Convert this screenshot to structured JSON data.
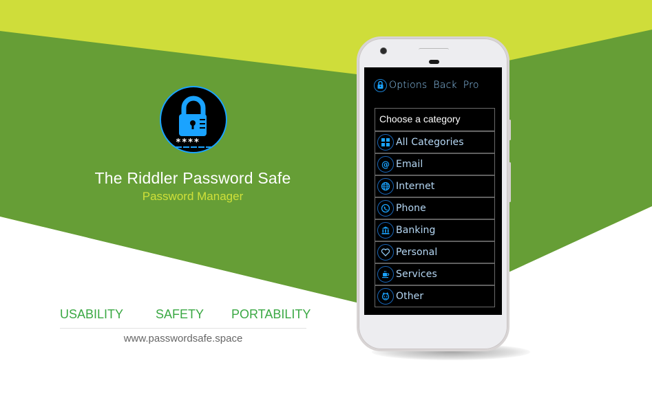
{
  "colors": {
    "lime": "#cfdd3a",
    "green": "#669e36",
    "white": "#ffffff",
    "accent_blue": "#1aa3ff",
    "feature_green": "#3aa843",
    "subtitle_lime": "#cfe03a"
  },
  "branding": {
    "logo_icon": "padlock-with-password-icon",
    "logo_mask": "****",
    "title": "The Riddler Password Safe",
    "subtitle": "Password Manager"
  },
  "features": [
    "USABILITY",
    "SAFETY",
    "PORTABILITY"
  ],
  "website": "www.passwordsafe.space",
  "app": {
    "toolbar": {
      "icon": "lock-icon",
      "menu": [
        "Options",
        "Back",
        "Pro"
      ]
    },
    "category_dropdown": {
      "header": "Choose a category",
      "items": [
        {
          "label": "All Categories",
          "icon": "grid-icon"
        },
        {
          "label": "Email",
          "icon": "at-sign-icon"
        },
        {
          "label": "Internet",
          "icon": "globe-icon"
        },
        {
          "label": "Phone",
          "icon": "phone-icon"
        },
        {
          "label": "Banking",
          "icon": "bank-icon"
        },
        {
          "label": "Personal",
          "icon": "heart-icon"
        },
        {
          "label": "Services",
          "icon": "coffee-cup-icon"
        },
        {
          "label": "Other",
          "icon": "face-icon"
        }
      ]
    }
  }
}
